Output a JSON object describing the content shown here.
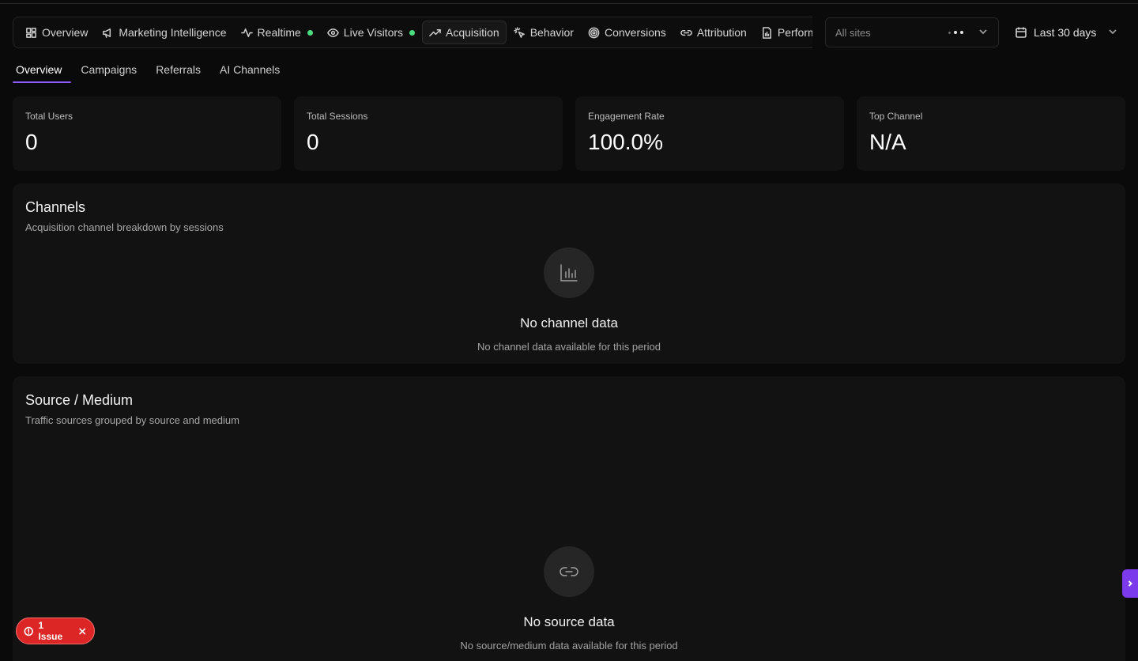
{
  "nav": {
    "items": [
      {
        "label": "Overview",
        "icon": "layout-grid-icon"
      },
      {
        "label": "Marketing Intelligence",
        "icon": "megaphone-icon"
      },
      {
        "label": "Realtime",
        "icon": "activity-icon",
        "live": true
      },
      {
        "label": "Live Visitors",
        "icon": "eye-icon",
        "live": true
      },
      {
        "label": "Acquisition",
        "icon": "trending-up-icon",
        "active": true
      },
      {
        "label": "Behavior",
        "icon": "pointer-click-icon"
      },
      {
        "label": "Conversions",
        "icon": "target-icon"
      },
      {
        "label": "Attribution",
        "icon": "link-icon"
      },
      {
        "label": "Perform",
        "icon": "file-chart-icon"
      }
    ],
    "live_color": "#4ade80"
  },
  "site_select": {
    "value": "All sites"
  },
  "date_select": {
    "value": "Last 30 days"
  },
  "subtabs": [
    {
      "label": "Overview",
      "active": true
    },
    {
      "label": "Campaigns"
    },
    {
      "label": "Referrals"
    },
    {
      "label": "AI Channels"
    }
  ],
  "stats": [
    {
      "label": "Total Users",
      "value": "0"
    },
    {
      "label": "Total Sessions",
      "value": "0"
    },
    {
      "label": "Engagement Rate",
      "value": "100.0%"
    },
    {
      "label": "Top Channel",
      "value": "N/A"
    }
  ],
  "channels": {
    "title": "Channels",
    "subtitle": "Acquisition channel breakdown by sessions",
    "empty_title": "No channel data",
    "empty_sub": "No channel data available for this period"
  },
  "source_medium": {
    "title": "Source / Medium",
    "subtitle": "Traffic sources grouped by source and medium",
    "empty_title": "No source data",
    "empty_sub": "No source/medium data available for this period"
  },
  "issue_badge": {
    "label": "1 Issue",
    "color": "#dc2626"
  },
  "accent": "#8b5cf6"
}
